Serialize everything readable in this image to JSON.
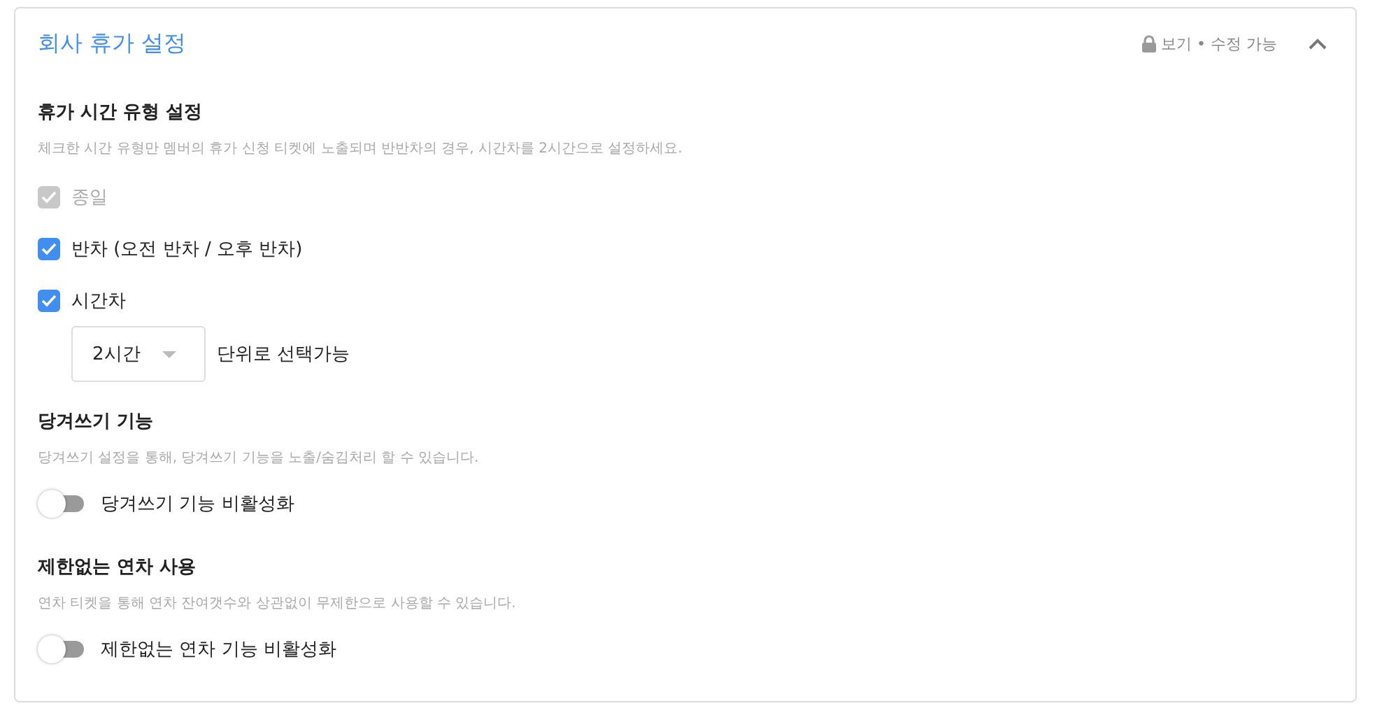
{
  "panel": {
    "title": "회사 휴가 설정",
    "permission": "보기 • 수정 가능",
    "expanded": true
  },
  "sections": [
    {
      "title": "휴가 시간 유형 설정",
      "description": "체크한 시간 유형만 멤버의 휴가 신청 티켓에 노출되며 반반차의 경우, 시간차를 2시간으로 설정하세요.",
      "items": [
        {
          "kind": "checkbox",
          "label": "종일",
          "checked": true,
          "disabled": true
        },
        {
          "kind": "checkbox",
          "label": "반차 (오전 반차 / 오후 반차)",
          "checked": true,
          "disabled": false
        },
        {
          "kind": "checkbox",
          "label": "시간차",
          "checked": true,
          "disabled": false
        },
        {
          "kind": "select",
          "value": "2시간",
          "suffix": "단위로 선택가능"
        }
      ]
    },
    {
      "title": "당겨쓰기 기능",
      "description": "당겨쓰기 설정을 통해, 당겨쓰기 기능을 노출/숨김처리 할 수 있습니다.",
      "items": [
        {
          "kind": "toggle",
          "label": "당겨쓰기 기능 비활성화",
          "on": false
        }
      ]
    },
    {
      "title": "제한없는 연차 사용",
      "description": "연차 티켓을 통해 연차 잔여갯수와 상관없이 무제한으로 사용할 수 있습니다.",
      "items": [
        {
          "kind": "toggle",
          "label": "제한없는 연차 기능 비활성화",
          "on": false
        }
      ]
    }
  ]
}
